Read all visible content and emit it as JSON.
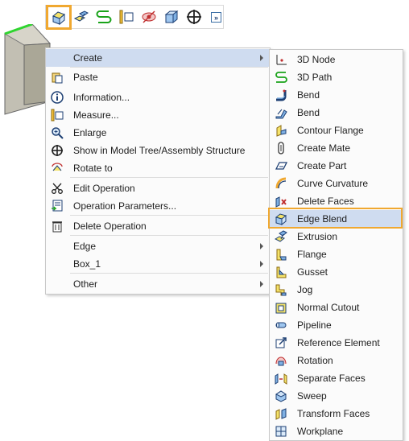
{
  "accent": "#f0a830",
  "toolbar": {
    "icons": [
      "edge-blend-icon",
      "extrusion-icon",
      "path-icon",
      "measure-icon",
      "hide-icon",
      "box-icon",
      "crosshair-icon"
    ],
    "more_label": "»"
  },
  "context_menu": {
    "items": [
      {
        "label": "Create",
        "icon": "",
        "submenu": true
      },
      {
        "label": "Paste",
        "icon": "paste-icon"
      },
      {
        "label": "Information...",
        "icon": "info-icon"
      },
      {
        "label": "Measure...",
        "icon": "measure-icon"
      },
      {
        "label": "Enlarge",
        "icon": "zoom-icon"
      },
      {
        "label": "Show in Model Tree/Assembly Structure",
        "icon": "crosshair-icon"
      },
      {
        "label": "Rotate to",
        "icon": "rotate-icon"
      },
      {
        "label": "Edit Operation",
        "icon": "scissors-icon"
      },
      {
        "label": "Operation Parameters...",
        "icon": "parameters-icon"
      },
      {
        "label": "Delete Operation",
        "icon": "trash-icon"
      },
      {
        "label": "Edge",
        "icon": "",
        "submenu": true
      },
      {
        "label": "Box_1",
        "icon": "",
        "submenu": true
      },
      {
        "label": "Other",
        "icon": "",
        "submenu": true
      }
    ]
  },
  "create_submenu": {
    "selected": "Edge Blend",
    "items": [
      {
        "label": "3D Node",
        "icon": "3d-node-icon"
      },
      {
        "label": "3D Path",
        "icon": "3d-path-icon"
      },
      {
        "label": "Bend",
        "icon": "bend-icon"
      },
      {
        "label": "Bend",
        "icon": "bend-alt-icon"
      },
      {
        "label": "Contour Flange",
        "icon": "contour-flange-icon"
      },
      {
        "label": "Create Mate",
        "icon": "create-mate-icon"
      },
      {
        "label": "Create Part",
        "icon": "create-part-icon"
      },
      {
        "label": "Curve Curvature",
        "icon": "curve-curvature-icon"
      },
      {
        "label": "Delete Faces",
        "icon": "delete-faces-icon"
      },
      {
        "label": "Edge Blend",
        "icon": "edge-blend-icon"
      },
      {
        "label": "Extrusion",
        "icon": "extrusion-icon"
      },
      {
        "label": "Flange",
        "icon": "flange-icon"
      },
      {
        "label": "Gusset",
        "icon": "gusset-icon"
      },
      {
        "label": "Jog",
        "icon": "jog-icon"
      },
      {
        "label": "Normal Cutout",
        "icon": "normal-cutout-icon"
      },
      {
        "label": "Pipeline",
        "icon": "pipeline-icon"
      },
      {
        "label": "Reference Element",
        "icon": "reference-element-icon"
      },
      {
        "label": "Rotation",
        "icon": "rotation-icon"
      },
      {
        "label": "Separate Faces",
        "icon": "separate-faces-icon"
      },
      {
        "label": "Sweep",
        "icon": "sweep-icon"
      },
      {
        "label": "Transform Faces",
        "icon": "transform-faces-icon"
      },
      {
        "label": "Workplane",
        "icon": "workplane-icon"
      }
    ]
  }
}
